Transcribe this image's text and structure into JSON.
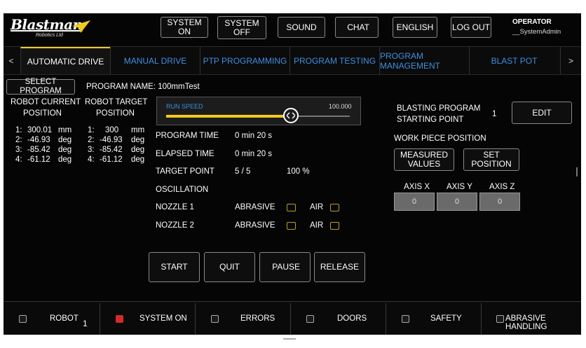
{
  "header": {
    "logo": "Blastman",
    "logo_sub": "Robotics Ltd",
    "buttons": {
      "system_on": "SYSTEM ON",
      "system_off": "SYSTEM OFF",
      "sound": "SOUND",
      "chat": "CHAT",
      "language": "ENGLISH",
      "logout": "LOG OUT"
    },
    "user_role": "OPERATOR",
    "user_name": "__SystemAdmin"
  },
  "tabs": {
    "prev": "<",
    "next": ">",
    "items": [
      "AUTOMATIC DRIVE",
      "MANUAL DRIVE",
      "PTP PROGRAMMING",
      "PROGRAM TESTING",
      "PROGRAM MANAGEMENT",
      "BLAST POT"
    ],
    "active": "AUTOMATIC DRIVE"
  },
  "program": {
    "select_label": "SELECT PROGRAM",
    "name_label": "PROGRAM NAME: 100mmTest"
  },
  "positions": {
    "current_title_1": "ROBOT CURRENT",
    "current_title_2": "POSITION",
    "target_title_1": "ROBOT TARGET",
    "target_title_2": "POSITION",
    "current": [
      {
        "idx": "1:",
        "val": "300.01",
        "unit": "mm"
      },
      {
        "idx": "2:",
        "val": "-46.93",
        "unit": "deg"
      },
      {
        "idx": "3:",
        "val": "-85.42",
        "unit": "deg"
      },
      {
        "idx": "4:",
        "val": "-61.12",
        "unit": "deg"
      }
    ],
    "target": [
      {
        "idx": "1:",
        "val": "300",
        "unit": "mm"
      },
      {
        "idx": "2:",
        "val": "-46.93",
        "unit": "deg"
      },
      {
        "idx": "3:",
        "val": "-85.42",
        "unit": "deg"
      },
      {
        "idx": "4:",
        "val": "-61.12",
        "unit": "deg"
      }
    ]
  },
  "run_speed": {
    "label": "RUN SPEED",
    "value": "100.000",
    "fraction": 0.68
  },
  "info": {
    "program_time_label": "PROGRAM TIME",
    "program_time": "0 min 20 s",
    "elapsed_time_label": "ELAPSED TIME",
    "elapsed_time": "0 min 20 s",
    "target_point_label": "TARGET POINT",
    "target_point": "5 / 5",
    "target_percent": "100 %",
    "oscillation_label": "OSCILLATION",
    "nozzle1_label": "NOZZLE 1",
    "nozzle2_label": "NOZZLE 2",
    "abrasive_label": "ABRASIVE",
    "air_label": "AIR"
  },
  "controls": {
    "start": "START",
    "quit": "QUIT",
    "pause": "PAUSE",
    "release": "RELEASE"
  },
  "blasting": {
    "title_1": "BLASTING PROGRAM",
    "title_2": "STARTING POINT",
    "value": "1",
    "edit": "EDIT",
    "work_piece_label": "WORK PIECE POSITION",
    "measured_1": "MEASURED",
    "measured_2": "VALUES",
    "set_position": "SET POSITION",
    "axis_x_label": "AXIS X",
    "axis_y_label": "AXIS Y",
    "axis_z_label": "AXIS Z",
    "axis_x": "0",
    "axis_y": "0",
    "axis_z": "0"
  },
  "status_bar": {
    "robot": "ROBOT",
    "robot_count": "1",
    "system_on": "SYSTEM ON",
    "errors": "ERRORS",
    "doors": "DOORS",
    "safety": "SAFETY",
    "abrasive_handling": "ABRASIVE HANDLING",
    "system_on_color": "#d42a2a"
  }
}
